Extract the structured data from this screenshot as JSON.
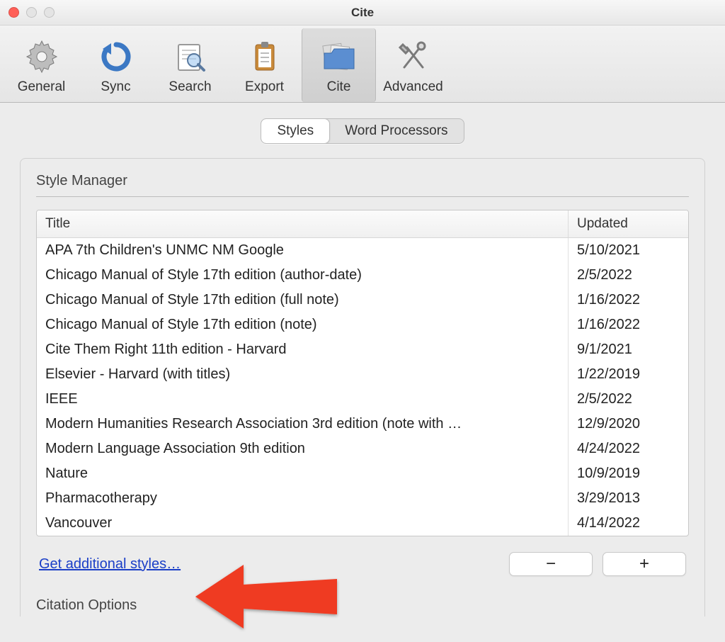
{
  "window": {
    "title": "Cite"
  },
  "toolbar": {
    "items": [
      {
        "label": "General"
      },
      {
        "label": "Sync"
      },
      {
        "label": "Search"
      },
      {
        "label": "Export"
      },
      {
        "label": "Cite"
      },
      {
        "label": "Advanced"
      }
    ]
  },
  "tabs": {
    "styles": "Styles",
    "word_processors": "Word Processors"
  },
  "style_manager": {
    "heading": "Style Manager",
    "columns": {
      "title": "Title",
      "updated": "Updated"
    },
    "rows": [
      {
        "title": "APA 7th Children's UNMC NM Google",
        "updated": "5/10/2021"
      },
      {
        "title": "Chicago Manual of Style 17th edition (author-date)",
        "updated": "2/5/2022"
      },
      {
        "title": "Chicago Manual of Style 17th edition (full note)",
        "updated": "1/16/2022"
      },
      {
        "title": "Chicago Manual of Style 17th edition (note)",
        "updated": "1/16/2022"
      },
      {
        "title": "Cite Them Right 11th edition - Harvard",
        "updated": "9/1/2021"
      },
      {
        "title": "Elsevier - Harvard (with titles)",
        "updated": "1/22/2019"
      },
      {
        "title": "IEEE",
        "updated": "2/5/2022"
      },
      {
        "title": "Modern Humanities Research Association 3rd edition (note with …",
        "updated": "12/9/2020"
      },
      {
        "title": "Modern Language Association 9th edition",
        "updated": "4/24/2022"
      },
      {
        "title": "Nature",
        "updated": "10/9/2019"
      },
      {
        "title": "Pharmacotherapy",
        "updated": "3/29/2013"
      },
      {
        "title": "Vancouver",
        "updated": "4/14/2022"
      }
    ],
    "get_more_link": "Get additional styles…",
    "minus": "−",
    "plus": "+"
  },
  "citation_options": {
    "heading": "Citation Options"
  }
}
